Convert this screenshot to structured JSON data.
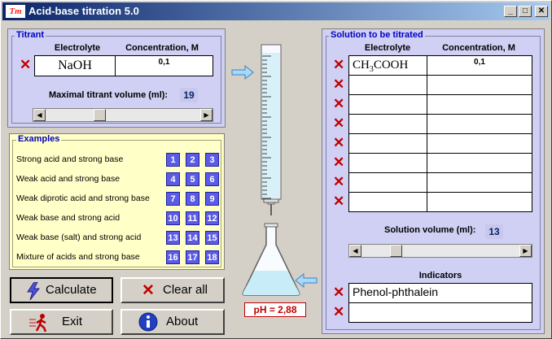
{
  "window": {
    "logo": "Tm",
    "title": "Acid-base titration 5.0",
    "min": "_",
    "max": "□",
    "close": "✕"
  },
  "titrant": {
    "title": "Titrant",
    "col_electrolyte": "Electrolyte",
    "col_concentration": "Concentration, M",
    "electrolyte": "NaOH",
    "concentration": "0,1",
    "max_volume_label": "Maximal titrant volume (ml):",
    "max_volume": "19",
    "slider_position": 0.4
  },
  "examples": {
    "title": "Examples",
    "rows": [
      {
        "label": "Strong acid and strong base",
        "nums": [
          "1",
          "2",
          "3"
        ]
      },
      {
        "label": "Weak acid and strong base",
        "nums": [
          "4",
          "5",
          "6"
        ]
      },
      {
        "label": "Weak diprotic acid and strong base",
        "nums": [
          "7",
          "8",
          "9"
        ]
      },
      {
        "label": "Weak base and strong acid",
        "nums": [
          "10",
          "11",
          "12"
        ]
      },
      {
        "label": "Weak base (salt) and strong acid",
        "nums": [
          "13",
          "14",
          "15"
        ]
      },
      {
        "label": "Mixture of acids and strong base",
        "nums": [
          "16",
          "17",
          "18"
        ]
      }
    ]
  },
  "buttons": {
    "calculate": "Calculate",
    "clear_all": "Clear all",
    "exit": "Exit",
    "about": "About"
  },
  "ph": {
    "text": "pH = 2,88"
  },
  "solution": {
    "title": "Solution to be titrated",
    "col_electrolyte": "Electrolyte",
    "col_concentration": "Concentration, M",
    "rows": [
      {
        "electrolyte_main": "CH",
        "electrolyte_sub": "3",
        "electrolyte_rest": "COOH",
        "concentration": "0,1"
      },
      {
        "electrolyte_main": "",
        "electrolyte_sub": "",
        "electrolyte_rest": "",
        "concentration": ""
      },
      {
        "electrolyte_main": "",
        "electrolyte_sub": "",
        "electrolyte_rest": "",
        "concentration": ""
      },
      {
        "electrolyte_main": "",
        "electrolyte_sub": "",
        "electrolyte_rest": "",
        "concentration": ""
      },
      {
        "electrolyte_main": "",
        "electrolyte_sub": "",
        "electrolyte_rest": "",
        "concentration": ""
      },
      {
        "electrolyte_main": "",
        "electrolyte_sub": "",
        "electrolyte_rest": "",
        "concentration": ""
      },
      {
        "electrolyte_main": "",
        "electrolyte_sub": "",
        "electrolyte_rest": "",
        "concentration": ""
      },
      {
        "electrolyte_main": "",
        "electrolyte_sub": "",
        "electrolyte_rest": "",
        "concentration": ""
      }
    ],
    "volume_label": "Solution volume (ml):",
    "volume": "13",
    "slider_position": 0.22,
    "indicators_title": "Indicators",
    "indicators": [
      "Phenol-phthalein",
      ""
    ]
  },
  "colors": {
    "accent": "#0000c0",
    "delete": "#c00000",
    "panel": "#d0d0f4",
    "examples_bg": "#ffffc8",
    "number_button": "#5b5be6"
  },
  "icons": {
    "delete": "red-x-icon",
    "calculate": "lightning-icon",
    "clear": "red-x-icon",
    "exit": "running-man-icon",
    "about": "info-icon",
    "arrow": "right-arrow-icon"
  }
}
